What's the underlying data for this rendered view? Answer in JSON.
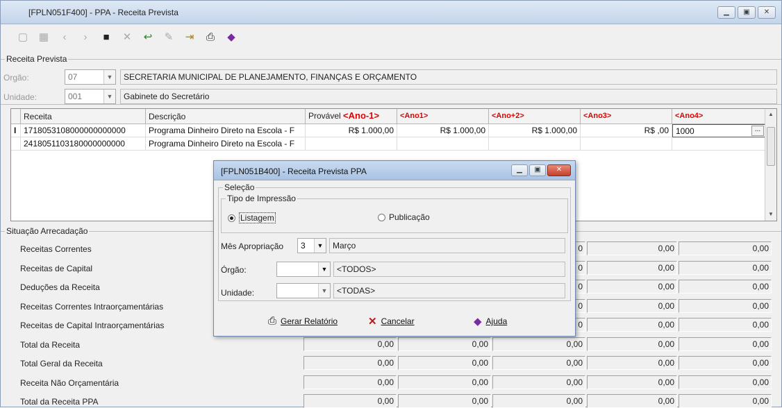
{
  "window": {
    "title": "[FPLN051F400] - PPA - Receita Prevista",
    "buttons": [
      "minimize",
      "maximize",
      "close"
    ]
  },
  "toolbar": {
    "icons": [
      "new-icon",
      "grid-icon",
      "prev-icon",
      "next-icon",
      "save-icon",
      "cancel-icon",
      "undo-icon",
      "edit-icon",
      "exit-icon",
      "print-icon",
      "help-book-icon"
    ]
  },
  "receita_prevista": {
    "group_label": "Receita Prevista",
    "orgao_label": "Orgão:",
    "orgao_value": "07",
    "orgao_desc": "SECRETARIA MUNICIPAL DE PLANEJAMENTO, FINANÇAS E ORÇAMENTO",
    "unidade_label": "Unidade:",
    "unidade_value": "001",
    "unidade_desc": "Gabinete do Secretário"
  },
  "grid": {
    "headers": {
      "receita": "Receita",
      "descricao": "Descrição",
      "provavel": "Provável",
      "ano_m1": "<Ano-1>",
      "ano1": "<Ano1>",
      "ano2": "<Ano+2>",
      "ano3": "<Ano3>",
      "ano4": "<Ano4>"
    },
    "rows": [
      {
        "indicator": "I",
        "receita": "1718053108000000000000",
        "descricao": "Programa Dinheiro Direto na Escola - F",
        "provavel": "R$ 1.000,00",
        "ano1": "R$ 1.000,00",
        "ano2": "R$ 1.000,00",
        "ano3": "R$ ,00",
        "ano4": "1000",
        "ellipsis": "..."
      },
      {
        "indicator": "",
        "receita": "2418051103180000000000",
        "descricao": "Programa Dinheiro Direto na Escola - F",
        "provavel": "",
        "ano1": "",
        "ano2": "",
        "ano3": "",
        "ano4": "",
        "ellipsis": ""
      }
    ]
  },
  "situacao": {
    "group_label": "Situação Arrecadação",
    "rows": [
      {
        "label": "Receitas Correntes",
        "v1": "",
        "v2": "",
        "v3": "0",
        "v4": "0,00",
        "v5": "0,00"
      },
      {
        "label": "Receitas de Capital",
        "v1": "",
        "v2": "",
        "v3": "0",
        "v4": "0,00",
        "v5": "0,00"
      },
      {
        "label": "Deduções da Receita",
        "v1": "",
        "v2": "",
        "v3": "0",
        "v4": "0,00",
        "v5": "0,00"
      },
      {
        "label": "Receitas Correntes Intraorçamentárias",
        "v1": "",
        "v2": "",
        "v3": "0",
        "v4": "0,00",
        "v5": "0,00"
      },
      {
        "label": "Receitas de Capital Intraorçamentárias",
        "v1": "",
        "v2": "",
        "v3": "0",
        "v4": "0,00",
        "v5": "0,00"
      },
      {
        "label": "Total da Receita",
        "v1": "0,00",
        "v2": "0,00",
        "v3": "0,00",
        "v4": "0,00",
        "v5": "0,00"
      },
      {
        "label": "Total Geral da Receita",
        "v1": "0,00",
        "v2": "0,00",
        "v3": "0,00",
        "v4": "0,00",
        "v5": "0,00"
      },
      {
        "label": "Receita Não Orçamentária",
        "v1": "0,00",
        "v2": "0,00",
        "v3": "0,00",
        "v4": "0,00",
        "v5": "0,00"
      },
      {
        "label": "Total da Receita PPA",
        "v1": "0,00",
        "v2": "0,00",
        "v3": "0,00",
        "v4": "0,00",
        "v5": "0,00"
      }
    ]
  },
  "dialog": {
    "title": "[FPLN051B400] - Receita Prevista PPA",
    "selecao_label": "Seleção",
    "tipo_label": "Tipo de Impressão",
    "radio_listagem": "Listagem",
    "radio_publicacao": "Publicação",
    "mes_label": "Mês Apropriação",
    "mes_value": "3",
    "mes_desc": "Março",
    "orgao_label": "Órgão:",
    "orgao_desc": "<TODOS>",
    "unidade_label": "Unidade:",
    "unidade_desc": "<TODAS>",
    "btn_gerar": "Gerar Relatório",
    "btn_cancelar": "Cancelar",
    "btn_ajuda": "Ajuda"
  }
}
